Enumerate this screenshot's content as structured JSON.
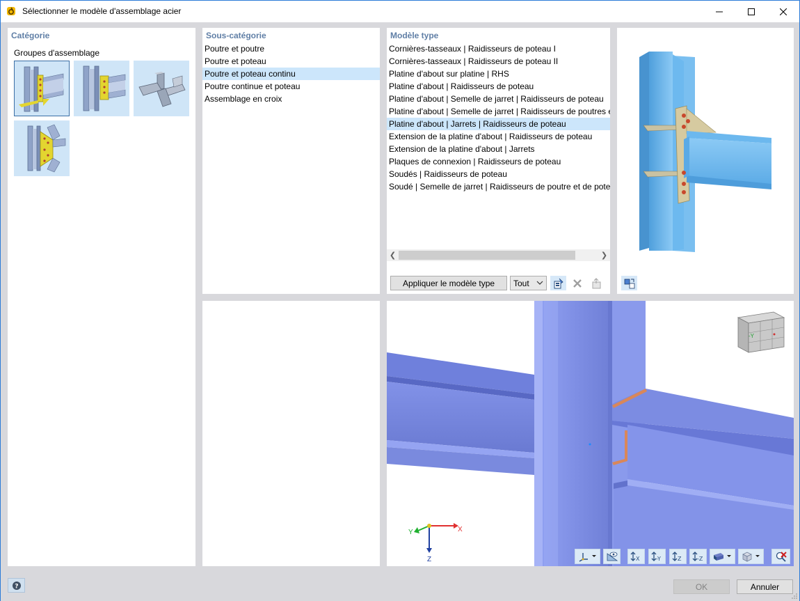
{
  "window": {
    "title": "Sélectionner le modèle d'assemblage acier"
  },
  "category": {
    "title": "Catégorie",
    "group_label": "Groupes d'assemblage"
  },
  "subcategory": {
    "title": "Sous-catégorie",
    "items": [
      {
        "label": "Poutre et poutre",
        "selected": false
      },
      {
        "label": "Poutre et poteau",
        "selected": false
      },
      {
        "label": "Poutre et poteau continu",
        "selected": true
      },
      {
        "label": "Poutre continue et poteau",
        "selected": false
      },
      {
        "label": "Assemblage en croix",
        "selected": false
      }
    ]
  },
  "model_type": {
    "title": "Modèle type",
    "items": [
      {
        "label": "Cornières-tasseaux | Raidisseurs de poteau I",
        "selected": false
      },
      {
        "label": "Cornières-tasseaux | Raidisseurs de poteau II",
        "selected": false
      },
      {
        "label": "Platine d'about sur platine | RHS",
        "selected": false
      },
      {
        "label": "Platine d'about | Raidisseurs de poteau",
        "selected": false
      },
      {
        "label": "Platine d'about | Semelle de jarret | Raidisseurs de poteau",
        "selected": false
      },
      {
        "label": "Platine d'about | Semelle de jarret | Raidisseurs de poutres et p",
        "selected": false
      },
      {
        "label": "Platine d'about | Jarrets | Raidisseurs de poteau",
        "selected": true
      },
      {
        "label": "Extension de la platine d'about | Raidisseurs de poteau",
        "selected": false
      },
      {
        "label": "Extension de la platine d'about | Jarrets",
        "selected": false
      },
      {
        "label": "Plaques de connexion | Raidisseurs de poteau",
        "selected": false
      },
      {
        "label": "Soudés | Raidisseurs de poteau",
        "selected": false
      },
      {
        "label": "Soudé | Semelle de jarret | Raidisseurs de poutre et de poteau",
        "selected": false
      }
    ],
    "apply_label": "Appliquer le modèle type",
    "filter_value": "Tout"
  },
  "view3d": {
    "axes": {
      "x": "X",
      "y": "Y",
      "z": "Z"
    },
    "cube_face_label": "-Y"
  },
  "footer": {
    "ok_label": "OK",
    "cancel_label": "Annuler"
  },
  "colors": {
    "accent_title": "#607fa6",
    "selection": "#cce6fb",
    "steel": "#7f8fe6",
    "preview_steel": "#6cb8ee"
  }
}
